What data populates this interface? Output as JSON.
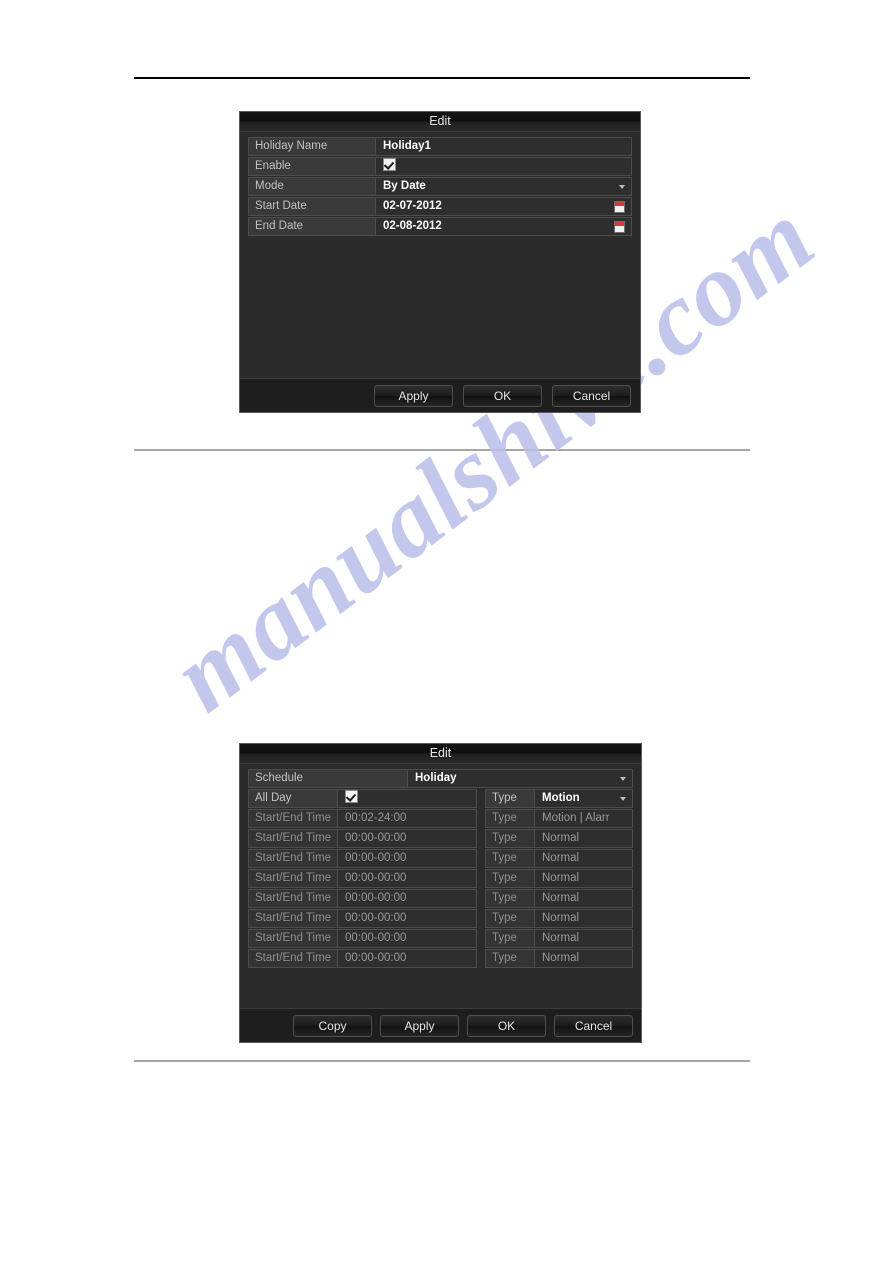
{
  "page": {
    "watermark": "manualshive.com"
  },
  "holiday_dialog": {
    "title": "Edit",
    "rows": [
      {
        "label": "Holiday Name",
        "value": "Holiday1",
        "kind": "text"
      },
      {
        "label": "Enable",
        "value": "",
        "kind": "checkbox"
      },
      {
        "label": "Mode",
        "value": "By Date",
        "kind": "select"
      },
      {
        "label": "Start Date",
        "value": "02-07-2012",
        "kind": "date"
      },
      {
        "label": "End Date",
        "value": "02-08-2012",
        "kind": "date"
      }
    ],
    "buttons": {
      "apply": "Apply",
      "ok": "OK",
      "cancel": "Cancel"
    }
  },
  "schedule_dialog": {
    "title": "Edit",
    "schedule_label": "Schedule",
    "schedule_value": "Holiday",
    "all_day_label": "All Day",
    "all_day_type_label": "Type",
    "all_day_type_value": "Motion",
    "time_rows": [
      {
        "label": "Start/End Time",
        "value": "00:02-24:00",
        "type_label": "Type",
        "type_value": "Motion | Alarr"
      },
      {
        "label": "Start/End Time",
        "value": "00:00-00:00",
        "type_label": "Type",
        "type_value": "Normal"
      },
      {
        "label": "Start/End Time",
        "value": "00:00-00:00",
        "type_label": "Type",
        "type_value": "Normal"
      },
      {
        "label": "Start/End Time",
        "value": "00:00-00:00",
        "type_label": "Type",
        "type_value": "Normal"
      },
      {
        "label": "Start/End Time",
        "value": "00:00-00:00",
        "type_label": "Type",
        "type_value": "Normal"
      },
      {
        "label": "Start/End Time",
        "value": "00:00-00:00",
        "type_label": "Type",
        "type_value": "Normal"
      },
      {
        "label": "Start/End Time",
        "value": "00:00-00:00",
        "type_label": "Type",
        "type_value": "Normal"
      },
      {
        "label": "Start/End Time",
        "value": "00:00-00:00",
        "type_label": "Type",
        "type_value": "Normal"
      }
    ],
    "buttons": {
      "copy": "Copy",
      "apply": "Apply",
      "ok": "OK",
      "cancel": "Cancel"
    }
  },
  "colors": {
    "dialog_bg": "#2b2b2b",
    "titlebar": "#101010",
    "label_cell": "#3a3a3a",
    "value_text": "#ffffff",
    "calendar_accent": "#d33a3a",
    "watermark": "#bcc0ea",
    "rule_top": "#000000",
    "rule_gray": "#a6a6a6"
  }
}
